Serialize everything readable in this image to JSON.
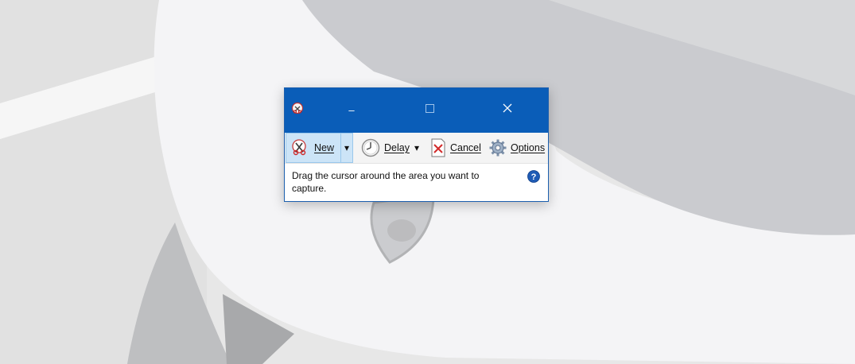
{
  "window": {
    "title": "",
    "minimize_symbol": "–",
    "maximize_symbol": "☐",
    "close_symbol": "✕"
  },
  "toolbar": {
    "new_label": "New",
    "delay_label": "Delay",
    "cancel_label": "Cancel",
    "options_label": "Options",
    "dropdown_arrow": "▾"
  },
  "content": {
    "instructions": "Drag the cursor around the area you want to capture."
  },
  "icons": [
    "snipping-tool-icon",
    "scissors-icon",
    "clock-icon",
    "cancel-x-icon",
    "gear-icon",
    "help-icon"
  ],
  "colors": {
    "titlebar": "#0a5db8",
    "selected_tool_bg": "#cce4f7",
    "help_icon": "#1f5bb5"
  }
}
